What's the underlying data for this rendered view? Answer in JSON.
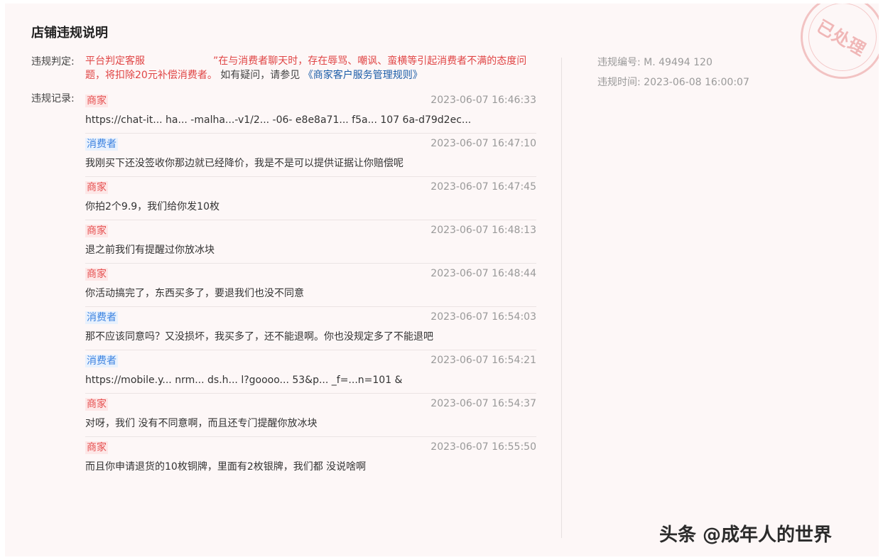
{
  "title": "店铺违规说明",
  "stamp": "已处理",
  "verdict": {
    "label": "违规判定:",
    "text_red_1": "平台判定客服",
    "text_red_2": "”在与消费者聊天时，存在辱骂、嘲讽、蛮横等引起消费者不满的态度问题，将扣除20元补偿消费者。",
    "text_tail": "如有疑问，请参见",
    "rule_link": "《商家客户服务管理规则》"
  },
  "meta": {
    "id_label": "违规编号:",
    "id_value": "M.            49494    120",
    "time_label": "违规时间:",
    "time_value": "2023-06-08 16:00:07"
  },
  "records_label": "违规记录:",
  "records": [
    {
      "role": "商家",
      "time": "2023-06-07 16:46:33",
      "msg": "https://chat-it...                    ha...  -malha...-v1/2...  -06-  e8e8a71...  f5a...     107 6a-d79d2ec..."
    },
    {
      "role": "消费者",
      "time": "2023-06-07 16:47:10",
      "msg": "我刚买下还没签收你那边就已经降价，我是不是可以提供证据让你赔偿呢"
    },
    {
      "role": "商家",
      "time": "2023-06-07 16:47:45",
      "msg": "你拍2个9.9，我们给你发10枚"
    },
    {
      "role": "商家",
      "time": "2023-06-07 16:48:13",
      "msg": "退之前我们有提醒过你放冰块"
    },
    {
      "role": "商家",
      "time": "2023-06-07 16:48:44",
      "msg": "你活动搞完了，东西买多了，要退我们也没不同意"
    },
    {
      "role": "消费者",
      "time": "2023-06-07 16:54:03",
      "msg": "那不应该同意吗？又没损坏，我买多了，还不能退啊。你也没规定多了不能退吧"
    },
    {
      "role": "消费者",
      "time": "2023-06-07 16:54:21",
      "msg": "https://mobile.y...              nrm...  ds.h...  l?goooo...              53&p...   _f=...n=101 &"
    },
    {
      "role": "商家",
      "time": "2023-06-07 16:54:37",
      "msg": "对呀，我们 没有不同意啊，而且还专门提醒你放冰块"
    },
    {
      "role": "商家",
      "time": "2023-06-07 16:55:50",
      "msg": "而且你申请退货的10枚铜牌，里面有2枚银牌，我们都 没说啥啊"
    }
  ],
  "watermark": "头条 @成年人的世界"
}
